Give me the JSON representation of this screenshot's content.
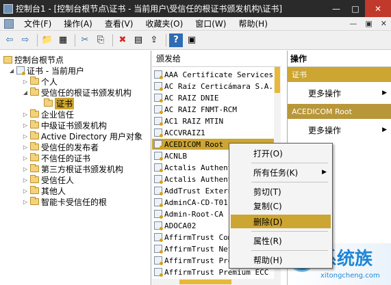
{
  "window": {
    "title": "控制台1 - [控制台根节点\\证书 - 当前用户\\受信任的根证书颁发机构\\证书]",
    "minimize": "—",
    "maximize": "□",
    "close": "✕"
  },
  "menu": {
    "items": [
      "文件(F)",
      "操作(A)",
      "查看(V)",
      "收藏夹(O)",
      "窗口(W)",
      "帮助(H)"
    ],
    "sub_min": "—",
    "sub_restore": "▣",
    "sub_close": "✕"
  },
  "toolbar": {
    "buttons": [
      "back-icon",
      "forward-icon",
      "up-folder-icon",
      "show-hide-tree-icon",
      "cut-icon",
      "copy-icon",
      "delete-icon",
      "properties-icon",
      "export-icon",
      "help-icon",
      "action-pane-icon"
    ],
    "glyphs": [
      "⇦",
      "⇨",
      "📁",
      "▦",
      "✂",
      "⎘",
      "✖",
      "▤",
      "⇪",
      "?",
      "▣"
    ]
  },
  "tree": {
    "root": "控制台根节点",
    "certs_user": "证书 - 当前用户",
    "personal": "个人",
    "trusted_root": "受信任的根证书颁发机构",
    "certs": "证书",
    "enterprise_trust": "企业信任",
    "intermediate": "中级证书颁发机构",
    "ad_user_object": "Active Directory 用户对象",
    "trusted_publishers": "受信任的发布者",
    "untrusted": "不信任的证书",
    "third_party_root": "第三方根证书颁发机构",
    "trusted_people": "受信任人",
    "others": "其他人",
    "smart_card_root": "智能卡受信任的根"
  },
  "list": {
    "header": "颁发给",
    "rows": [
      "AAA Certificate Services",
      "AC Raíz Certicámara S.A.",
      "AC RAIZ DNIE",
      "AC RAIZ FNMT-RCM",
      "AC1 RAIZ MTIN",
      "ACCVRAIZ1",
      "ACEDICOM Root",
      "ACNLB",
      "Actalis Authent",
      "Actalis Authent",
      "AddTrust Extern",
      "AdminCA-CD-T01",
      "Admin-Root-CA",
      "ADOCA02",
      "AffirmTrust Com",
      "AffirmTrust Net",
      "AffirmTrust Pre",
      "AffirmTrust Premium ECC"
    ],
    "selected_index": 6
  },
  "actions": {
    "header": "操作",
    "group1": "证书",
    "more1": "更多操作",
    "group2": "ACEDICOM Root",
    "more2": "更多操作",
    "arrow": "▶"
  },
  "context_menu": {
    "open": "打开(O)",
    "all_tasks": "所有任务(K)",
    "cut": "剪切(T)",
    "copy": "复制(C)",
    "delete": "删除(D)",
    "properties": "属性(R)",
    "help": "帮助(H)",
    "submenu_arrow": "▶"
  },
  "watermark": {
    "text": "系统族",
    "url": "xitongcheng.com"
  }
}
